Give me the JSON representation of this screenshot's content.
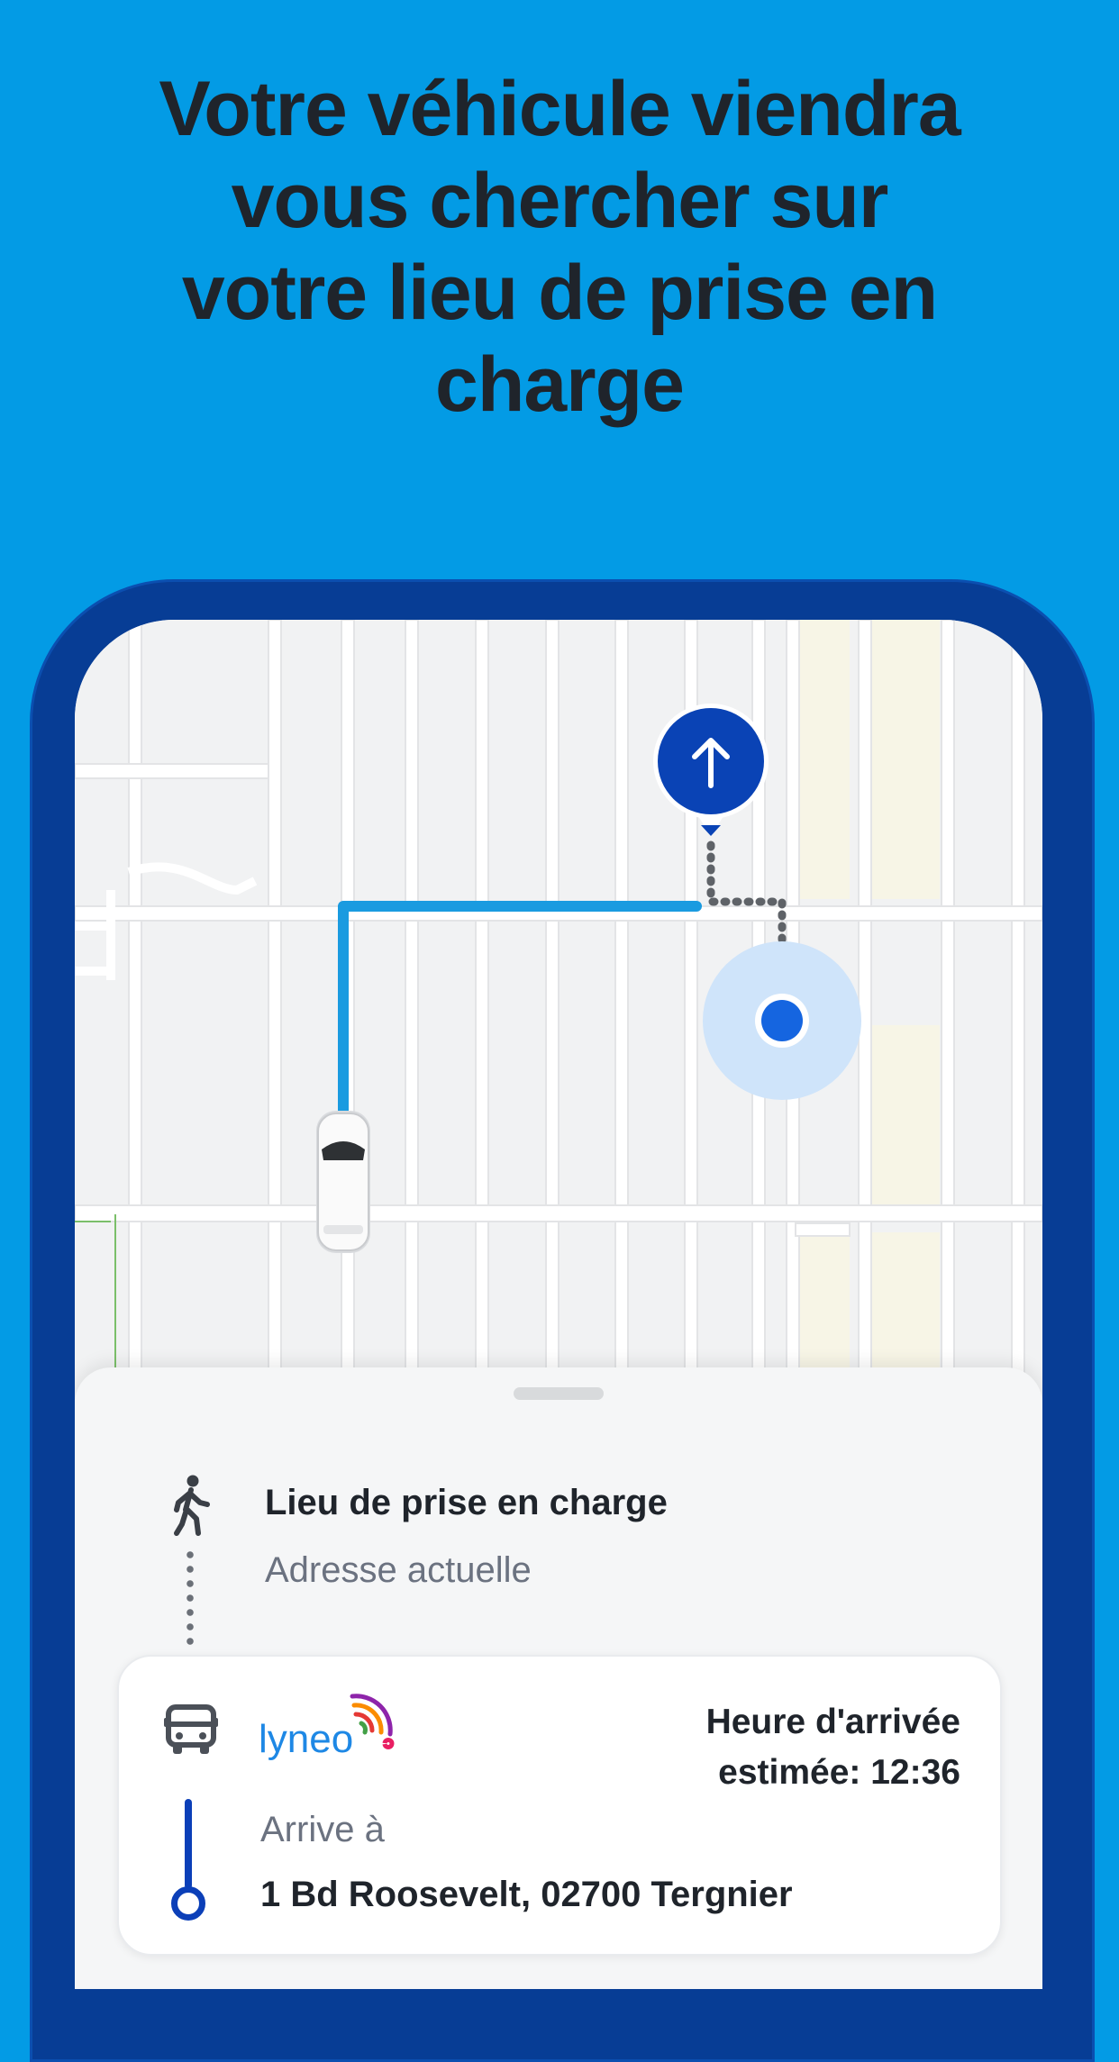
{
  "headline": "Votre véhicule viendra vous chercher sur votre lieu de prise en charge",
  "sheet": {
    "pickup_title": "Lieu de prise en charge",
    "pickup_subtitle": "Adresse actuelle",
    "card": {
      "brand_logo_text": "lyneo",
      "eta_line1": "Heure d'arrivée",
      "eta_line2": "estimée: 12:36",
      "arrive_label": "Arrive à",
      "address": "1 Bd Roosevelt, 02700 Tergnier"
    }
  },
  "icons": {
    "pin": "arrow-up-icon",
    "walk": "walking-person-icon",
    "vehicle": "bus-icon",
    "car": "car-icon"
  },
  "colors": {
    "background": "#039be5",
    "phone_frame": "#073d95",
    "route": "#1a9be0",
    "pin": "#0a43b5",
    "location_dot": "#1565e0"
  }
}
